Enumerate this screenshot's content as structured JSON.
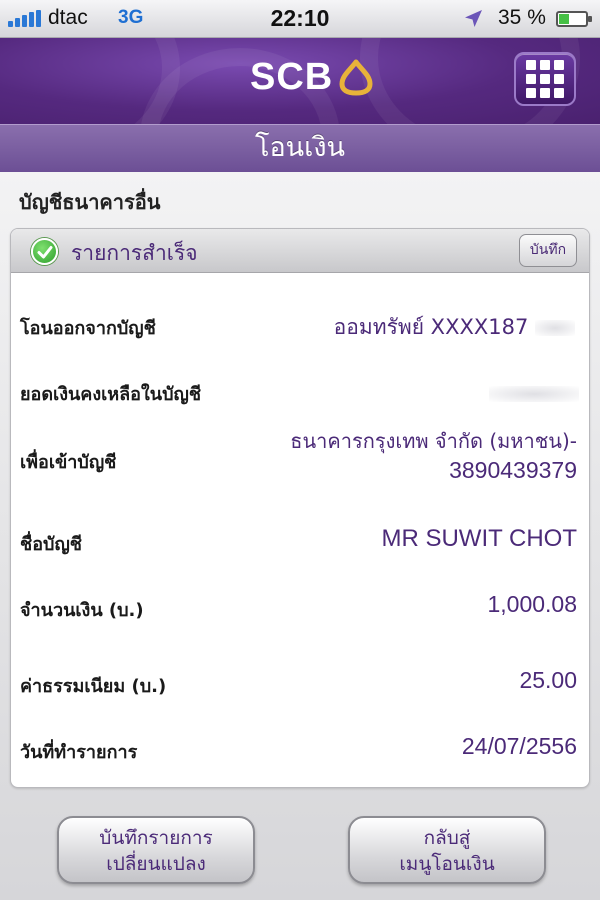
{
  "status_bar": {
    "carrier": "dtac",
    "network": "3G",
    "time": "22:10",
    "battery": "35 %",
    "battery_level": 0.35,
    "icons": [
      "signal-icon",
      "location-arrow-icon",
      "battery-icon"
    ]
  },
  "header": {
    "brand": "SCB",
    "screen_title": "โอนเงิน",
    "menu_icon": "grid-menu-icon",
    "colors": {
      "brand_purple": "#55297f",
      "accent_gold": "#e8b23a"
    }
  },
  "section": {
    "title": "บัญชีธนาคารอื่น"
  },
  "result": {
    "status": "รายการสำเร็จ",
    "save_label": "บันทึก",
    "status_icon": "check-circle-icon",
    "status_color": "#2d9f2c"
  },
  "details": [
    {
      "label": "โอนออกจากบัญชี",
      "value": "ออมทรัพย์ XXXX187"
    },
    {
      "label": "ยอดเงินคงเหลือในบัญชี",
      "value": ""
    },
    {
      "label": "เพื่อเข้าบัญชี",
      "value_line1": "ธนาคารกรุงเทพ จำกัด (มหาชน)-",
      "value_line2": "3890439379"
    },
    {
      "label": "ชื่อบัญชี",
      "value": "MR SUWIT CHOT"
    },
    {
      "label": "จำนวนเงิน (บ.)",
      "value": "1,000.08"
    },
    {
      "label": "ค่าธรรมเนียม (บ.)",
      "value": "25.00"
    },
    {
      "label": "วันที่ทำรายการ",
      "value": "24/07/2556"
    }
  ],
  "buttons": {
    "save_favorite_line1": "บันทึกรายการ",
    "save_favorite_line2": "เปลี่ยนแปลง",
    "back_line1": "กลับสู่",
    "back_line2": "เมนูโอนเงิน"
  }
}
